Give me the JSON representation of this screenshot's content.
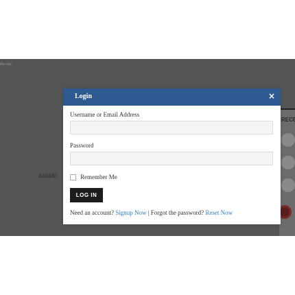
{
  "background": {
    "site_text": "the site",
    "filler_text": "dddddd",
    "recent_label": "RECE"
  },
  "modal": {
    "title": "Login",
    "close_glyph": "×",
    "username_label": "Username or Email Address",
    "username_value": "",
    "password_label": "Password",
    "password_value": "",
    "remember_label": "Remember Me",
    "remember_checked": false,
    "login_button": "LOG IN",
    "footer": {
      "need_account": "Need an account?",
      "signup_link": "Signup Now",
      "separator": "|",
      "forgot_text": "Forgot the password?",
      "reset_link": "Reset Now"
    }
  },
  "colors": {
    "header_bg": "#2f5a91",
    "link": "#2d7ec4",
    "button_bg": "#1c1c1c",
    "overlay": "#555555"
  },
  "icons": {
    "close": "close-icon",
    "checkbox": "checkbox-icon"
  }
}
